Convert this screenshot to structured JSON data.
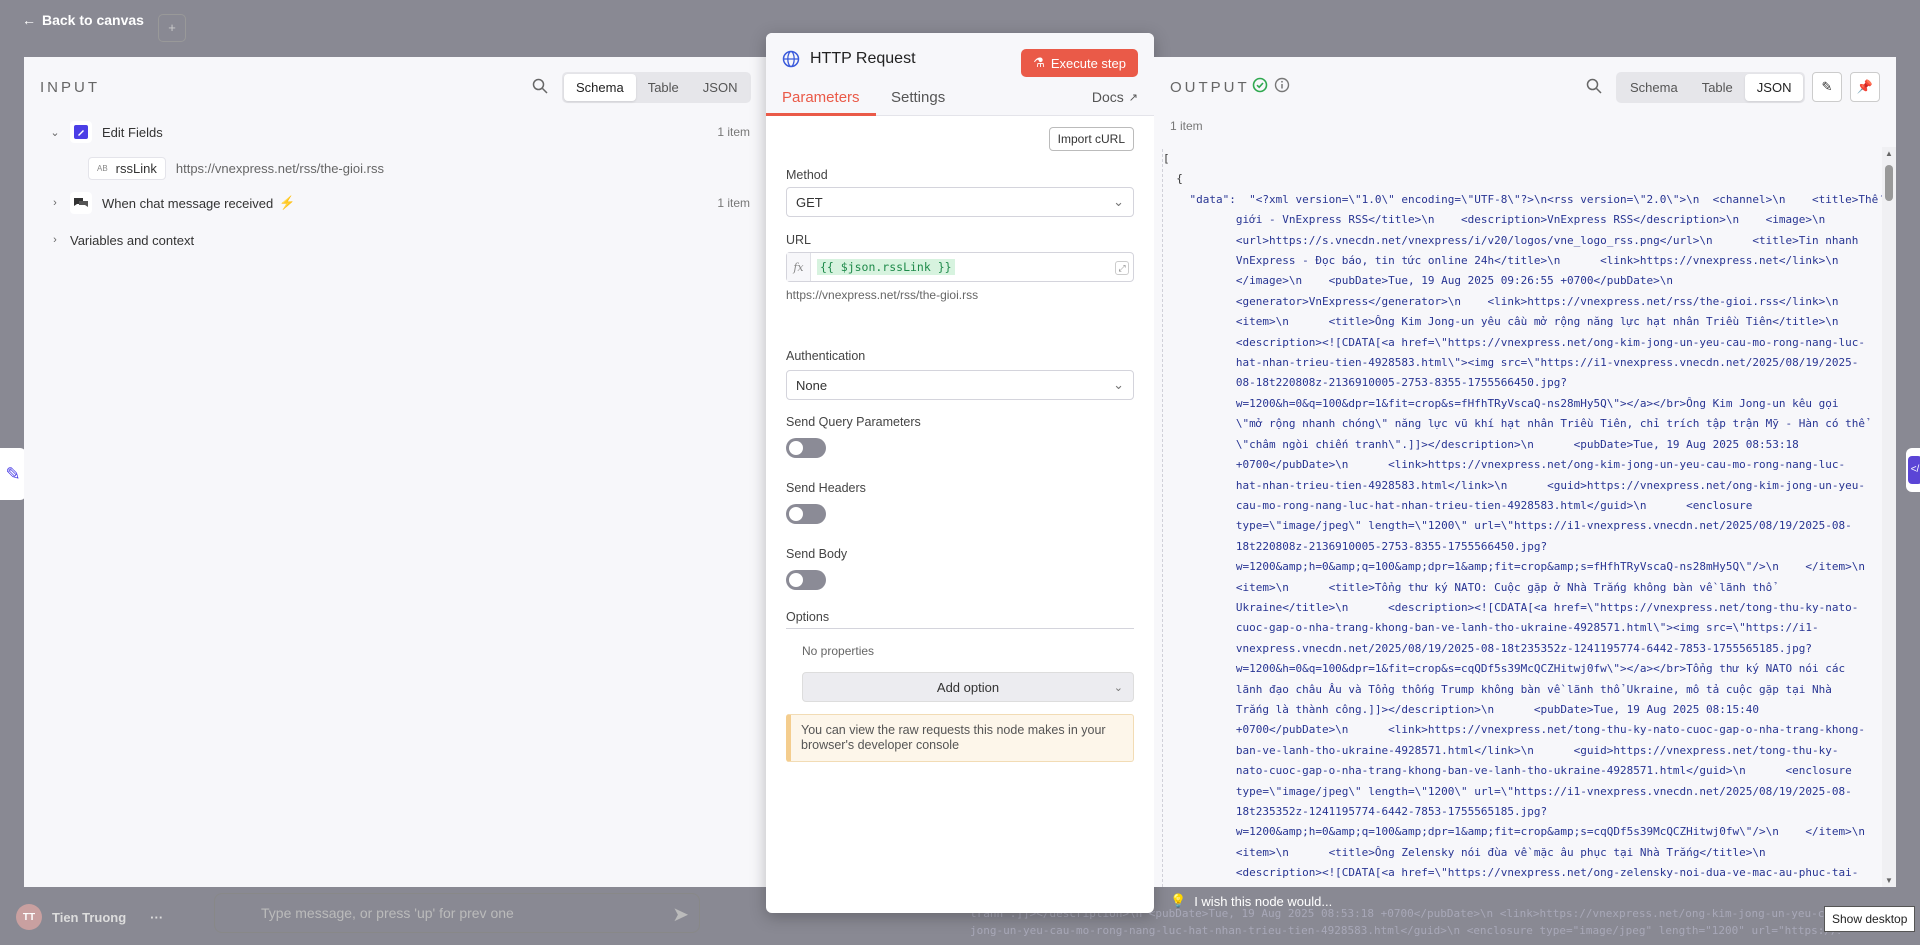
{
  "background": {
    "back_label": "Back to canvas",
    "user_name": "Tien Truong",
    "user_initials": "TT",
    "chat_placeholder": "Type message, or press 'up' for prev one",
    "raw_text": "tranh\".]]></description>\\n <pubDate>Tue, 19 Aug 2025 08:53:18 +0700</pubDate>\\n <link>https://vnexpress.net/ong-kim-jong-un-yeu-cau-mo-rong-nang-luc-hat-nhan-trieu-tien-4928583.html</link>\\n <guid>https://vnexpress.net/ong-kim-",
    "raw_text2": "jong-un-yeu-cau-mo-rong-nang-luc-hat-nhan-trieu-tien-4928583.html</guid>\\n <enclosure type=\"image/jpeg\" length=\"1200\" url=\"https://i1-",
    "show_desktop": "Show desktop"
  },
  "input": {
    "title": "INPUT",
    "views": [
      "Schema",
      "Table",
      "JSON"
    ],
    "active_view": "Schema",
    "tree": [
      {
        "label": "Edit Fields",
        "count": "1 item"
      },
      {
        "label": "When chat message received",
        "count": "1 item"
      },
      {
        "label": "Variables and context"
      }
    ],
    "field": {
      "type": "AB",
      "name": "rssLink",
      "value": "https://vnexpress.net/rss/the-gioi.rss"
    }
  },
  "node": {
    "title": "HTTP Request",
    "execute_label": "Execute step",
    "tabs": [
      "Parameters",
      "Settings"
    ],
    "docs_label": "Docs",
    "import_curl": "Import cURL",
    "method_label": "Method",
    "method_value": "GET",
    "url_label": "URL",
    "url_expression": "{{ $json.rssLink }}",
    "url_resolved": "https://vnexpress.net/rss/the-gioi.rss",
    "auth_label": "Authentication",
    "auth_value": "None",
    "send_query_label": "Send Query Parameters",
    "send_headers_label": "Send Headers",
    "send_body_label": "Send Body",
    "options_label": "Options",
    "no_properties": "No properties",
    "add_option": "Add option",
    "notice": "You can view the raw requests this node makes in your browser's developer console"
  },
  "output": {
    "title": "OUTPUT",
    "views": [
      "Schema",
      "Table",
      "JSON"
    ],
    "active_view": "JSON",
    "count": "1 item",
    "json_lines": [
      "[",
      "  {",
      "    \"data\":  \"<?xml version=\\\"1.0\\\" encoding=\\\"UTF-8\\\"?>\\n<rss version=\\\"2.0\\\">\\n  <channel>\\n    <title>Thế",
      "           giới - VnExpress RSS</title>\\n    <description>VnExpress RSS</description>\\n    <image>\\n",
      "           <url>https://s.vnecdn.net/vnexpress/i/v20/logos/vne_logo_rss.png</url>\\n      <title>Tin nhanh",
      "           VnExpress - Đọc báo, tin tức online 24h</title>\\n      <link>https://vnexpress.net</link>\\n",
      "           </image>\\n    <pubDate>Tue, 19 Aug 2025 09:26:55 +0700</pubDate>\\n",
      "           <generator>VnExpress</generator>\\n    <link>https://vnexpress.net/rss/the-gioi.rss</link>\\n",
      "           <item>\\n      <title>Ông Kim Jong-un yêu cầu mở rộng năng lực hạt nhân Triều Tiên</title>\\n",
      "           <description><![CDATA[<a href=\\\"https://vnexpress.net/ong-kim-jong-un-yeu-cau-mo-rong-nang-luc-",
      "           hat-nhan-trieu-tien-4928583.html\\\"><img src=\\\"https://i1-vnexpress.vnecdn.net/2025/08/19/2025-",
      "           08-18t220808z-2136910005-2753-8355-1755566450.jpg?",
      "           w=1200&h=0&q=100&dpr=1&fit=crop&s=fHfhTRyVscaQ-ns28mHy5Q\\\"></a></br>Ông Kim Jong-un kêu gọi",
      "           \\\"mở rộng nhanh chóng\\\" năng lực vũ khí hạt nhân Triều Tiên, chỉ trích tập trận Mỹ - Hàn có thể",
      "           \\\"châm ngòi chiến tranh\\\".]]></description>\\n      <pubDate>Tue, 19 Aug 2025 08:53:18",
      "           +0700</pubDate>\\n      <link>https://vnexpress.net/ong-kim-jong-un-yeu-cau-mo-rong-nang-luc-",
      "           hat-nhan-trieu-tien-4928583.html</link>\\n      <guid>https://vnexpress.net/ong-kim-jong-un-yeu-",
      "           cau-mo-rong-nang-luc-hat-nhan-trieu-tien-4928583.html</guid>\\n      <enclosure",
      "           type=\\\"image/jpeg\\\" length=\\\"1200\\\" url=\\\"https://i1-vnexpress.vnecdn.net/2025/08/19/2025-08-",
      "           18t220808z-2136910005-2753-8355-1755566450.jpg?",
      "           w=1200&amp;h=0&amp;q=100&amp;dpr=1&amp;fit=crop&amp;s=fHfhTRyVscaQ-ns28mHy5Q\\\"/>\\n    </item>\\n",
      "           <item>\\n      <title>Tổng thư ký NATO: Cuộc gặp ở Nhà Trắng không bàn về lãnh thổ",
      "           Ukraine</title>\\n      <description><![CDATA[<a href=\\\"https://vnexpress.net/tong-thu-ky-nato-",
      "           cuoc-gap-o-nha-trang-khong-ban-ve-lanh-tho-ukraine-4928571.html\\\"><img src=\\\"https://i1-",
      "           vnexpress.vnecdn.net/2025/08/19/2025-08-18t235352z-1241195774-6442-7853-1755565185.jpg?",
      "           w=1200&h=0&q=100&dpr=1&fit=crop&s=cqQDf5s39McQCZHitwj0fw\\\"></a></br>Tổng thư ký NATO nói các",
      "           lãnh đạo châu Âu và Tổng thống Trump không bàn về lãnh thổ Ukraine, mô tả cuộc gặp tại Nhà",
      "           Trắng là thành công.]]></description>\\n      <pubDate>Tue, 19 Aug 2025 08:15:40",
      "           +0700</pubDate>\\n      <link>https://vnexpress.net/tong-thu-ky-nato-cuoc-gap-o-nha-trang-khong-",
      "           ban-ve-lanh-tho-ukraine-4928571.html</link>\\n      <guid>https://vnexpress.net/tong-thu-ky-",
      "           nato-cuoc-gap-o-nha-trang-khong-ban-ve-lanh-tho-ukraine-4928571.html</guid>\\n      <enclosure",
      "           type=\\\"image/jpeg\\\" length=\\\"1200\\\" url=\\\"https://i1-vnexpress.vnecdn.net/2025/08/19/2025-08-",
      "           18t235352z-1241195774-6442-7853-1755565185.jpg?",
      "           w=1200&amp;h=0&amp;q=100&amp;dpr=1&amp;fit=crop&amp;s=cqQDf5s39McQCZHitwj0fw\\\"/>\\n    </item>\\n",
      "           <item>\\n      <title>Ông Zelensky nói đùa về mặc âu phục tại Nhà Trắng</title>\\n",
      "           <description><![CDATA[<a href=\\\"https://vnexpress.net/ong-zelensky-noi-dua-ve-mac-au-phuc-tai-"
    ],
    "wish_label": "I wish this node would..."
  },
  "colors": {
    "accent": "#ea5a48",
    "success": "#2fa84f",
    "brand": "#5b45d6"
  }
}
